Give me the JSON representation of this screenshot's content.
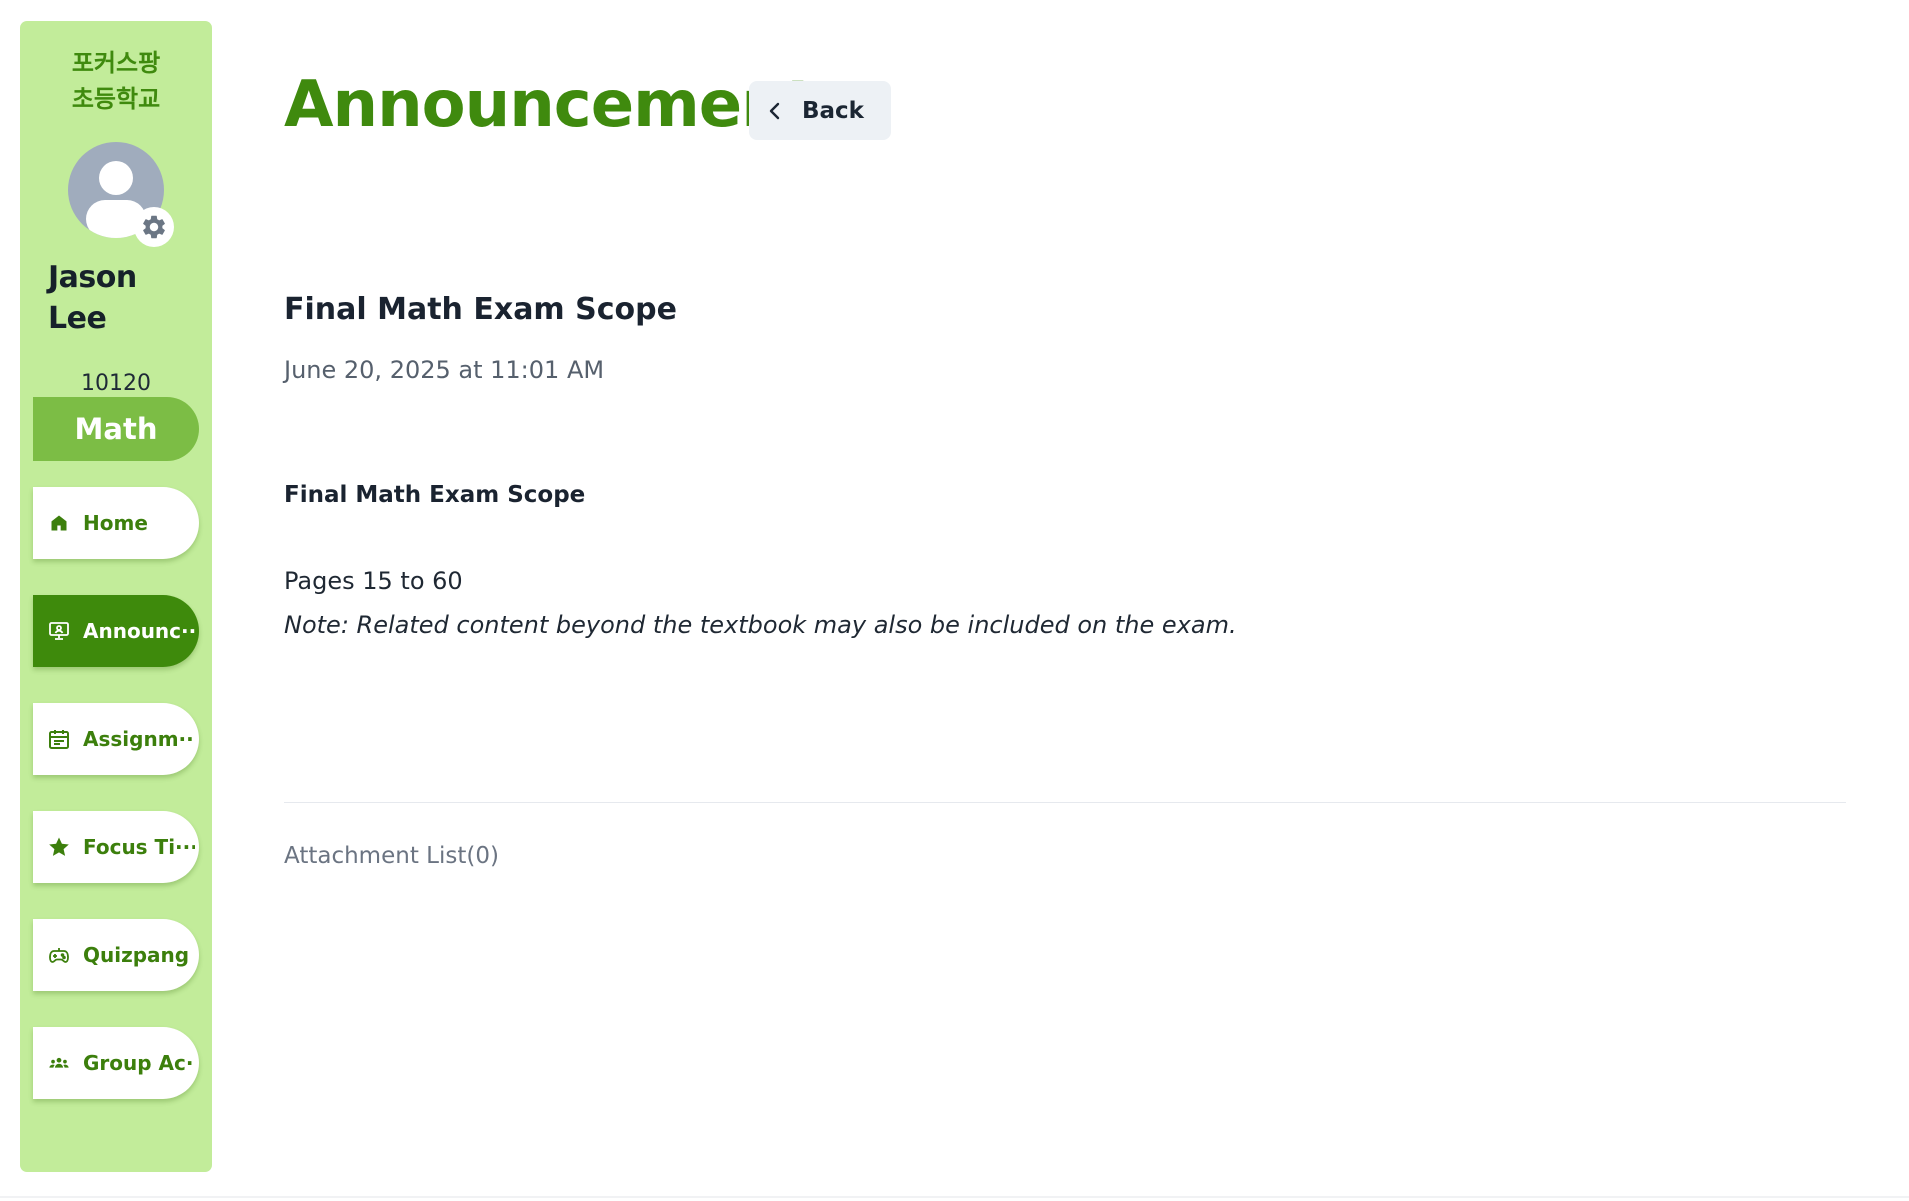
{
  "sidebar": {
    "school_name_line1": "포커스팡",
    "school_name_line2": "초등학교",
    "user": {
      "first_name": "Jason",
      "last_name": "Lee",
      "id": "10120"
    },
    "subject": "Math",
    "nav_items": [
      {
        "label": "Home",
        "icon": "home-icon",
        "active": false
      },
      {
        "label": "Announc···",
        "icon": "presentation-icon",
        "active": true
      },
      {
        "label": "Assignm···",
        "icon": "calendar-icon",
        "active": false
      },
      {
        "label": "Focus Ti···",
        "icon": "star-icon",
        "active": false
      },
      {
        "label": "Quizpang",
        "icon": "gamepad-icon",
        "active": false
      },
      {
        "label": "Group Ac···",
        "icon": "group-icon",
        "active": false
      }
    ]
  },
  "header": {
    "title": "Announcement",
    "back_label": "Back"
  },
  "post": {
    "title": "Final Math Exam Scope",
    "date": "June 20, 2025 at 11:01 AM",
    "body_heading": "Final Math Exam Scope",
    "body_line": "Pages 15 to 60",
    "body_note": "Note: Related content beyond the textbook may also be included on the exam.",
    "attachments_label": "Attachment List(0)"
  },
  "colors": {
    "sidebar_bg": "#c2ec9a",
    "brand_green": "#3f8a0e",
    "subject_pill": "#7cbd45",
    "active_nav": "#3e8a0c",
    "back_button_bg": "#edf1f5"
  }
}
